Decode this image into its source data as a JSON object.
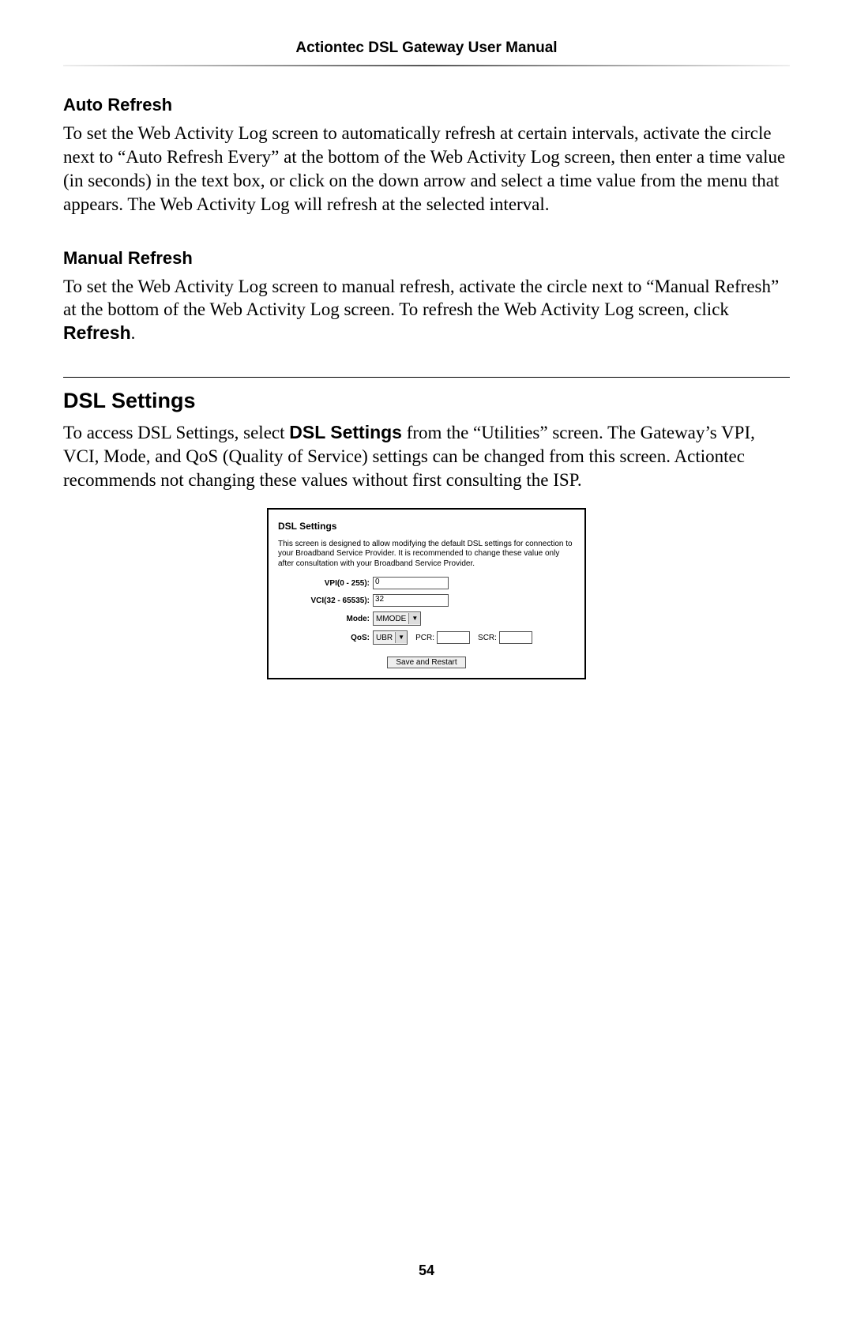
{
  "header": "Actiontec DSL Gateway User Manual",
  "auto_refresh": {
    "title": "Auto Refresh",
    "body": "To set the Web Activity Log screen to automatically refresh at certain intervals, activate the circle next to “Auto Refresh Every” at the bottom of the Web Activity Log screen, then enter a time value (in seconds) in the text box, or click on the down arrow and select a time value from the menu that appears. The Web Activity Log will refresh at the selected interval."
  },
  "manual_refresh": {
    "title": "Manual Refresh",
    "body_pre": "To set the Web Activity Log screen to manual refresh, activate the circle next to “Manual Refresh” at the bottom of the Web Activity Log screen. To refresh the Web Activity Log screen, click ",
    "body_bold": "Refresh",
    "body_post": "."
  },
  "dsl": {
    "title": "DSL Settings",
    "body_pre": "To access DSL Settings, select ",
    "body_bold": "DSL Settings",
    "body_post": " from the “Utilities” screen. The Gateway’s VPI, VCI, Mode, and QoS (Quality of Service) settings can be changed from this screen. Actiontec recommends not changing these values without first consulting the ISP."
  },
  "screenshot": {
    "title": "DSL Settings",
    "desc": "This screen is designed to allow modifying the default DSL settings for connection to your Broadband Service Provider. It is recommended to change these value only after consultation with your Broadband Service Provider.",
    "vpi_label": "VPI(0 - 255):",
    "vpi_value": "0",
    "vci_label": "VCI(32 - 65535):",
    "vci_value": "32",
    "mode_label": "Mode:",
    "mode_value": "MMODE",
    "qos_label": "QoS:",
    "qos_value": "UBR",
    "pcr_label": "PCR:",
    "pcr_value": "",
    "scr_label": "SCR:",
    "scr_value": "",
    "button": "Save and Restart"
  },
  "page_number": "54"
}
